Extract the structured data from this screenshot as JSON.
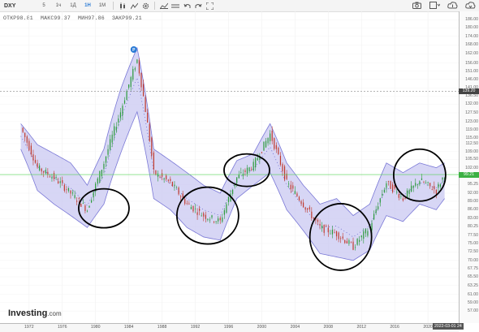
{
  "toolbar": {
    "symbol": "DXY",
    "intervals": [
      "5",
      "1ч",
      "1Д",
      "1Н",
      "1М"
    ],
    "active_interval": "1Н",
    "left_icons": [
      "candles-icon",
      "indicators-icon",
      "settings-icon",
      "drawing-icon",
      "lines-icon",
      "undo-icon",
      "redo-icon",
      "fullscreen-icon"
    ],
    "right_icons": [
      "camera-icon",
      "layout-icon",
      "cloud-upload-icon",
      "cloud-download-icon"
    ]
  },
  "ohlc": {
    "open": "ОТКР98.81",
    "high": "МАКС99.37",
    "low": "МИН97.86",
    "close": "ЗАКР99.21"
  },
  "yaxis": {
    "ticks": [
      "186.00",
      "180.00",
      "174.00",
      "168.00",
      "162.00",
      "156.00",
      "151.00",
      "146.00",
      "141.00",
      "136.50",
      "132.00",
      "127.50",
      "123.00",
      "119.00",
      "115.00",
      "112.50",
      "109.00",
      "105.50",
      "102.00",
      "98.50",
      "95.25",
      "92.00",
      "89.00",
      "86.00",
      "83.00",
      "80.25",
      "77.50",
      "75.00",
      "72.50",
      "70.00",
      "67.75",
      "65.50",
      "63.25",
      "61.00",
      "59.00",
      "57.00"
    ],
    "crosshair_price": "139.20",
    "current_price": "99.21"
  },
  "xaxis": {
    "ticks": [
      "1972",
      "1976",
      "1980",
      "1984",
      "1988",
      "1992",
      "1996",
      "2000",
      "2004",
      "2008",
      "2012",
      "2016",
      "2020"
    ],
    "current_date": "2022-03-01",
    "current_time": "24"
  },
  "marker": {
    "label": "P"
  },
  "logo": {
    "name": "Investing",
    "suffix": ".com"
  },
  "colors": {
    "up": "#2a9a3a",
    "down": "#c0392b",
    "band_fill": "#c9c8f2",
    "band_line": "#7a78d6",
    "price_line": "#55d255",
    "circle": "#000000",
    "marker": "#2a7ad5"
  },
  "chart_data": {
    "type": "candlestick",
    "scale": "log",
    "ylim": [
      55,
      190
    ],
    "x": [
      1971,
      1973,
      1975,
      1977,
      1979,
      1981,
      1983,
      1985,
      1987,
      1989,
      1991,
      1993,
      1995,
      1997,
      1999,
      2001,
      2003,
      2005,
      2007,
      2009,
      2011,
      2013,
      2015,
      2017,
      2019,
      2021,
      2022
    ],
    "close": [
      120,
      102,
      98,
      92,
      86,
      104,
      128,
      158,
      100,
      96,
      88,
      84,
      82,
      98,
      103,
      117,
      96,
      88,
      80,
      78,
      74,
      80,
      96,
      90,
      97,
      93,
      99.21
    ],
    "band_upper": [
      122,
      112,
      108,
      104,
      95,
      110,
      140,
      166,
      110,
      105,
      100,
      95,
      92,
      105,
      108,
      122,
      104,
      95,
      88,
      90,
      84,
      88,
      104,
      100,
      104,
      102,
      104
    ],
    "band_lower": [
      110,
      93,
      88,
      84,
      80,
      88,
      108,
      128,
      90,
      86,
      80,
      77,
      76,
      90,
      95,
      100,
      86,
      79,
      72,
      71,
      70,
      73,
      84,
      82,
      88,
      86,
      90
    ]
  }
}
